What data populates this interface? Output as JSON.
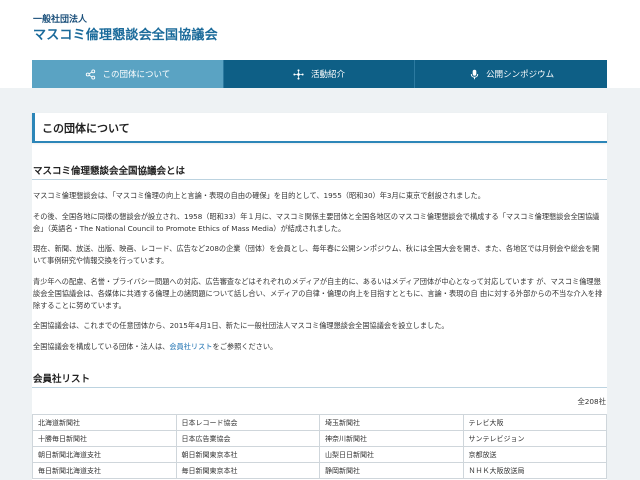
{
  "header": {
    "org_type": "一般社団法人",
    "org_name": "マスコミ倫理懇談会全国協議会"
  },
  "nav": {
    "items": [
      {
        "label": "この団体について",
        "icon": "share-nodes-icon",
        "active": true
      },
      {
        "label": "活動紹介",
        "icon": "network-icon",
        "active": false
      },
      {
        "label": "公開シンポジウム",
        "icon": "microphone-icon",
        "active": false
      }
    ]
  },
  "page": {
    "title": "この団体について"
  },
  "about": {
    "heading": "マスコミ倫理懇談会全国協議会とは",
    "p1": "マスコミ倫理懇談会は、「マスコミ倫理の向上と言論・表現の自由の確保」を目的として、1955（昭和30）年3月に東京で創設されました。",
    "p2": "その後、全国各地に同様の懇談会が設立され、1958（昭和33）年１月に、マスコミ関係主要団体と全国各地区のマスコミ倫理懇談会で構成する「マスコミ倫理懇談会全国協議会」（英語名・The National Council to Promote Ethics of Mass Media）が結成されました。",
    "p3": "現在、新聞、放送、出版、映画、レコード、広告など208の企業（団体）を会員とし、毎年春に公開シンポジウム、秋には全国大会を開き、また、各地区では月例会や総会を開いて事例研究や情報交換を行っています。",
    "p4": "青少年への配慮、名誉・プライバシー問題への対応、広告審査などはそれぞれのメディアが自主的に、あるいはメディア団体が中心となって対応しています が、マスコミ倫理懇談会全国協議会は、各媒体に共通する倫理上の諸問題について話し合い、メディアの自律・倫理の向上を目指すとともに、言論・表現の自 由に対する外部からの不当な介入を排除することに努めています。",
    "p5": "全国協議会は、これまでの任意団体から、2015年4月1日、新たに一般社団法人マスコミ倫理懇談会全国協議会を設立しました。",
    "p6_before": "全国協議会を構成している団体・法人は、",
    "p6_link": "会員社リスト",
    "p6_after": "をご参照ください。"
  },
  "members": {
    "heading": "会員社リスト",
    "total": "全208社",
    "rows": [
      [
        "北海道新聞社",
        "日本レコード協会",
        "埼玉新聞社",
        "テレビ大阪"
      ],
      [
        "十勝毎日新聞社",
        "日本広告業協会",
        "神奈川新聞社",
        "サンテレビジョン"
      ],
      [
        "朝日新聞北海道支社",
        "朝日新聞東京本社",
        "山梨日日新聞社",
        "京都放送"
      ],
      [
        "毎日新聞北海道支社",
        "毎日新聞東京本社",
        "静岡新聞社",
        "ＮＨＫ大阪放送局"
      ]
    ]
  }
}
